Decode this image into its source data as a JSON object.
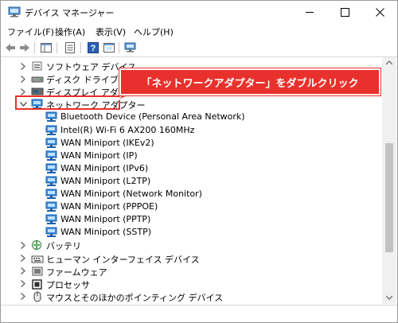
{
  "window": {
    "title": "デバイス マネージャー"
  },
  "menu": [
    "ファイル(F)",
    "操作(A)",
    "表示(V)",
    "ヘルプ(H)"
  ],
  "toolbar": [
    "back-icon",
    "forward-icon",
    "properties-icon",
    "console-tree-icon",
    "help-icon",
    "view-icon",
    "scan-hardware-icon"
  ],
  "tree": {
    "rows": [
      {
        "label": "ソフトウェア デバイス",
        "expanded": false,
        "icon": "software-device-icon"
      },
      {
        "label": "ディスク ドライブ",
        "expanded": false,
        "icon": "disk-drive-icon"
      },
      {
        "label": "ディスプレイ アダプター",
        "expanded": false,
        "icon": "display-adapter-icon"
      },
      {
        "label": "ネットワーク アダプター",
        "expanded": true,
        "icon": "network-adapter-icon"
      },
      {
        "label": "Bluetooth Device (Personal Area Network)",
        "icon": "network-adapter-icon"
      },
      {
        "label": "Intel(R) Wi-Fi 6 AX200 160MHz",
        "icon": "network-adapter-icon"
      },
      {
        "label": "WAN Miniport (IKEv2)",
        "icon": "network-adapter-icon"
      },
      {
        "label": "WAN Miniport (IP)",
        "icon": "network-adapter-icon"
      },
      {
        "label": "WAN Miniport (IPv6)",
        "icon": "network-adapter-icon"
      },
      {
        "label": "WAN Miniport (L2TP)",
        "icon": "network-adapter-icon"
      },
      {
        "label": "WAN Miniport (Network Monitor)",
        "icon": "network-adapter-icon"
      },
      {
        "label": "WAN Miniport (PPPOE)",
        "icon": "network-adapter-icon"
      },
      {
        "label": "WAN Miniport (PPTP)",
        "icon": "network-adapter-icon"
      },
      {
        "label": "WAN Miniport (SSTP)",
        "icon": "network-adapter-icon"
      },
      {
        "label": "バッテリ",
        "expanded": false,
        "icon": "battery-icon"
      },
      {
        "label": "ヒューマン インターフェイス デバイス",
        "expanded": false,
        "icon": "hid-icon"
      },
      {
        "label": "ファームウェア",
        "expanded": false,
        "icon": "firmware-icon"
      },
      {
        "label": "プロセッサ",
        "expanded": false,
        "icon": "processor-icon"
      },
      {
        "label": "マウスとそのほかのポインティング デバイス",
        "expanded": false,
        "icon": "mouse-icon"
      }
    ]
  },
  "annotation": {
    "text": "「ネットワークアダプター」をダブルクリック"
  },
  "colors": {
    "annotation": "#e8312c",
    "network_icon": "#2e86d8",
    "chevron": "#5a5a5a"
  }
}
